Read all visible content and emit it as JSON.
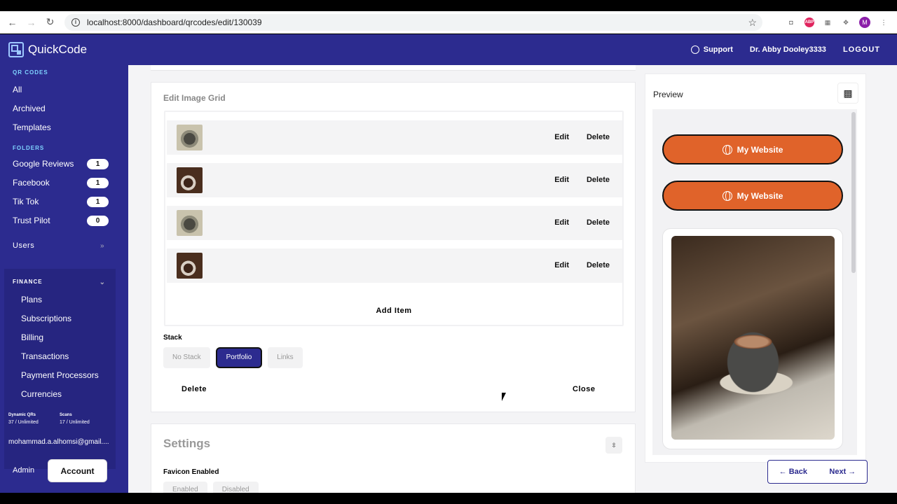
{
  "browser": {
    "url": "localhost:8000/dashboard/qrcodes/edit/130039",
    "avatar_letter": "M",
    "abp_label": "ABP"
  },
  "header": {
    "app_name": "QuickCode",
    "support": "Support",
    "user": "Dr. Abby Dooley3333",
    "logout": "LOGOUT"
  },
  "sidebar": {
    "qr_title": "QR CODES",
    "qr_items": [
      "All",
      "Archived",
      "Templates"
    ],
    "folders_title": "FOLDERS",
    "folders": [
      {
        "label": "Google Reviews",
        "count": "1"
      },
      {
        "label": "Facebook",
        "count": "1"
      },
      {
        "label": "Tik Tok",
        "count": "1"
      },
      {
        "label": "Trust Pilot",
        "count": "0"
      }
    ],
    "users": "Users",
    "finance_title": "FINANCE",
    "finance_items": [
      "Plans",
      "Subscriptions",
      "Billing",
      "Transactions",
      "Payment Processors",
      "Currencies"
    ],
    "stats": [
      {
        "label": "Dynamic QRs",
        "value": "37 / Unlimited"
      },
      {
        "label": "Scans",
        "value": "17 / Unlimited"
      }
    ],
    "email": "mohammad.a.alhomsi@gmail....",
    "admin": "Admin",
    "account": "Account"
  },
  "edit_card": {
    "title": "Edit Image Grid",
    "rows": [
      {
        "edit": "Edit",
        "delete": "Delete"
      },
      {
        "edit": "Edit",
        "delete": "Delete"
      },
      {
        "edit": "Edit",
        "delete": "Delete"
      },
      {
        "edit": "Edit",
        "delete": "Delete"
      }
    ],
    "add_item": "Add Item",
    "stack_label": "Stack",
    "stack_options": [
      "No Stack",
      "Portfolio",
      "Links"
    ],
    "stack_selected": "Portfolio",
    "delete": "Delete",
    "close": "Close"
  },
  "settings": {
    "title": "Settings",
    "favicon_label": "Favicon Enabled",
    "favicon_options": [
      "Enabled",
      "Disabled"
    ]
  },
  "preview": {
    "title": "Preview",
    "buttons": [
      "My Website",
      "My Website"
    ],
    "brand_color": "#e0632a"
  },
  "footer_nav": {
    "back": "Back",
    "next": "Next"
  }
}
